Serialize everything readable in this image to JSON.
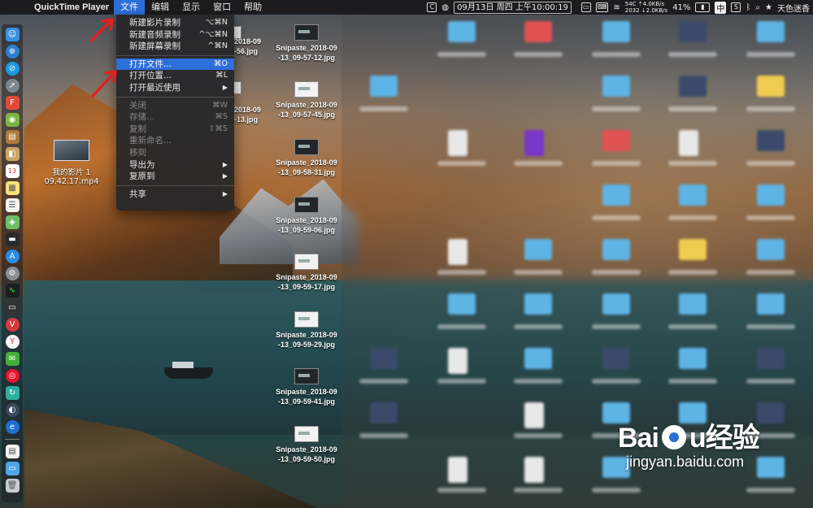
{
  "menubar": {
    "app_name": "QuickTime Player",
    "menus": [
      "文件",
      "编辑",
      "显示",
      "窗口",
      "帮助"
    ],
    "status": {
      "net_up": "54C ⇡4.0KB/s",
      "net_down": "2032 ⇣2.0KB/s",
      "datetime": "09月13日 周四 上午10:00:19",
      "battery": "41%",
      "input_method": "中",
      "user": "天色迷香"
    }
  },
  "file_menu": {
    "items": [
      {
        "label": "新建影片录制",
        "shortcut": "⌥⌘N",
        "disabled": false
      },
      {
        "label": "新建音频录制",
        "shortcut": "^⌥⌘N",
        "disabled": false
      },
      {
        "label": "新建屏幕录制",
        "shortcut": "^⌘N",
        "disabled": false
      },
      {
        "label": "打开文件...",
        "shortcut": "⌘O",
        "disabled": false,
        "highlighted": true
      },
      {
        "label": "打开位置...",
        "shortcut": "⌘L",
        "disabled": false
      },
      {
        "label": "打开最近使用",
        "shortcut": "▶",
        "disabled": false
      },
      {
        "label": "关闭",
        "shortcut": "⌘W",
        "disabled": true
      },
      {
        "label": "存储...",
        "shortcut": "⌘S",
        "disabled": true
      },
      {
        "label": "复制",
        "shortcut": "⇧⌘S",
        "disabled": true
      },
      {
        "label": "重新命名...",
        "shortcut": "",
        "disabled": true
      },
      {
        "label": "移到",
        "shortcut": "",
        "disabled": true
      },
      {
        "label": "导出为",
        "shortcut": "▶",
        "disabled": false
      },
      {
        "label": "复原到",
        "shortcut": "▶",
        "disabled": false
      },
      {
        "label": "共享",
        "shortcut": "▶",
        "disabled": false
      }
    ]
  },
  "desktop_file": {
    "line1": "我的影片 1",
    "line2": "09.42.17.mp4"
  },
  "files_partial": [
    {
      "line1": "2018-09",
      "line2": "-56.jpg"
    },
    {
      "line1": "2018-09",
      "line2": "-13.jpg"
    }
  ],
  "files": [
    {
      "line1": "Snipaste_2018-09",
      "line2": "-13_09-57-12.jpg"
    },
    {
      "line1": "Snipaste_2018-09",
      "line2": "-13_09-57-45.jpg"
    },
    {
      "line1": "Snipaste_2018-09",
      "line2": "-13_09-58-31.jpg"
    },
    {
      "line1": "Snipaste_2018-09",
      "line2": "-13_09-59-06.jpg"
    },
    {
      "line1": "Snipaste_2018-09",
      "line2": "-13_09-59-17.jpg"
    },
    {
      "line1": "Snipaste_2018-09",
      "line2": "-13_09-59-29.jpg"
    },
    {
      "line1": "Snipaste_2018-09",
      "line2": "-13_09-59-41.jpg"
    },
    {
      "line1": "Snipaste_2018-09",
      "line2": "-13_09-59-50.jpg"
    }
  ],
  "watermark": {
    "brand": "Bai",
    "brand2": "u",
    "cn": "经验",
    "url": "jingyan.baidu.com"
  },
  "colors": {
    "menu_highlight": "#2d6fd9",
    "arrow": "#e02020"
  }
}
